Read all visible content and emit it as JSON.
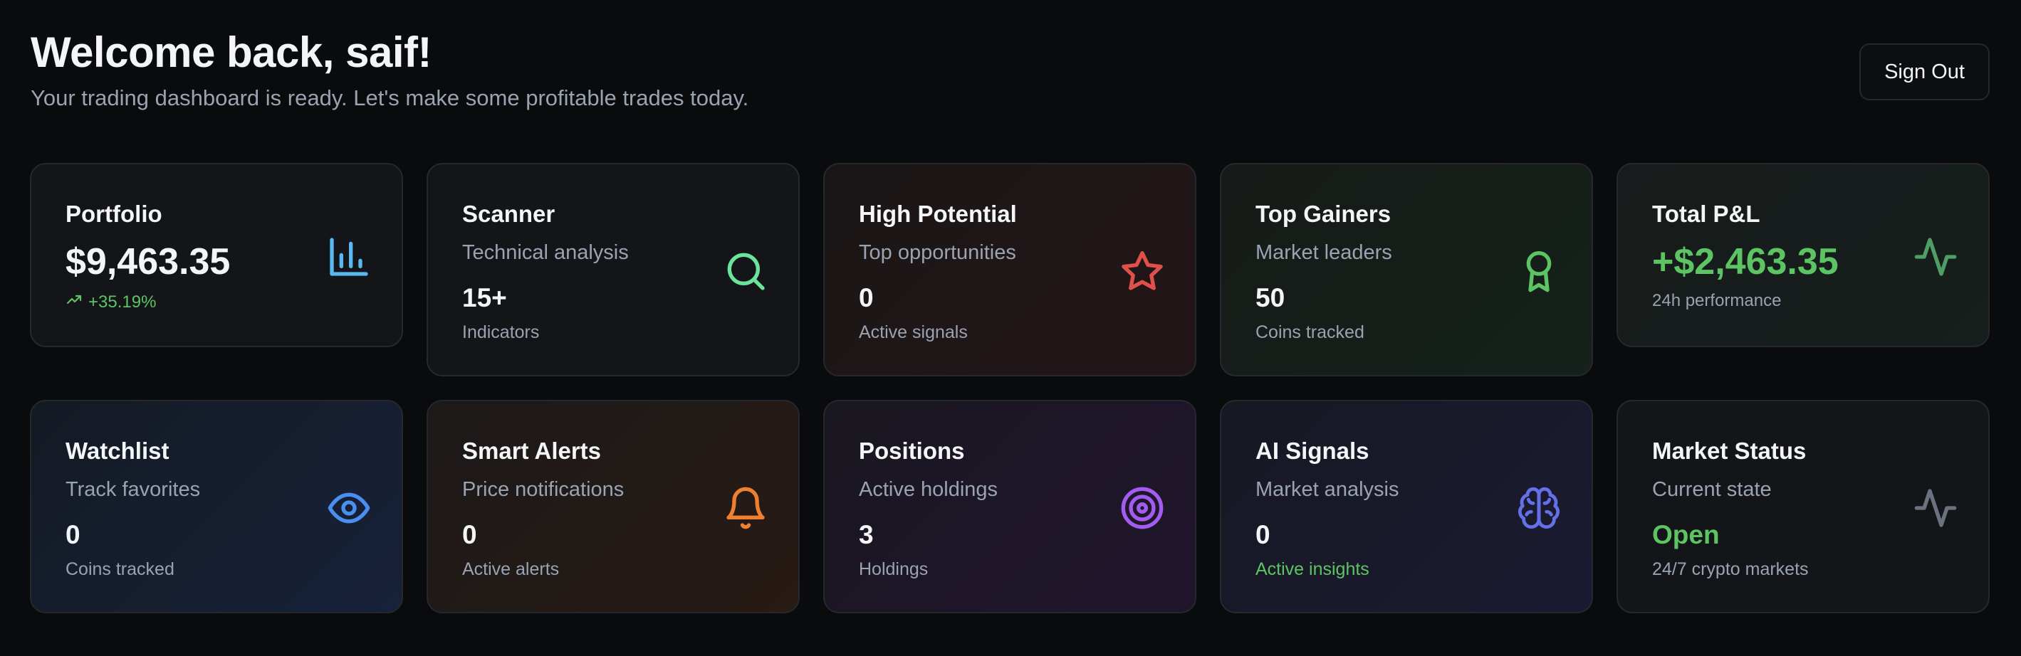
{
  "header": {
    "title": "Welcome back, saif!",
    "subtitle": "Your trading dashboard is ready. Let's make some profitable trades today.",
    "signout_label": "Sign Out"
  },
  "cards": {
    "portfolio": {
      "title": "Portfolio",
      "value": "$9,463.35",
      "change": "+35.19%",
      "icon": "bar-chart-icon",
      "accent": "#5ab8f0"
    },
    "scanner": {
      "title": "Scanner",
      "subtitle": "Technical analysis",
      "value": "15+",
      "footer": "Indicators",
      "icon": "search-icon",
      "accent": "#6be39a"
    },
    "high_potential": {
      "title": "High Potential",
      "subtitle": "Top opportunities",
      "value": "0",
      "footer": "Active signals",
      "icon": "star-icon",
      "accent": "#e0504a"
    },
    "top_gainers": {
      "title": "Top Gainers",
      "subtitle": "Market leaders",
      "value": "50",
      "footer": "Coins tracked",
      "icon": "award-icon",
      "accent": "#5cc462"
    },
    "total_pnl": {
      "title": "Total P&L",
      "value": "+$2,463.35",
      "footer": "24h performance",
      "icon": "activity-icon",
      "accent": "#5cc462"
    },
    "watchlist": {
      "title": "Watchlist",
      "subtitle": "Track favorites",
      "value": "0",
      "footer": "Coins tracked",
      "icon": "eye-icon",
      "accent": "#4a8ff0"
    },
    "smart_alerts": {
      "title": "Smart Alerts",
      "subtitle": "Price notifications",
      "value": "0",
      "footer": "Active alerts",
      "icon": "bell-icon",
      "accent": "#ef8030"
    },
    "positions": {
      "title": "Positions",
      "subtitle": "Active holdings",
      "value": "3",
      "footer": "Holdings",
      "icon": "target-icon",
      "accent": "#a45cf0"
    },
    "ai_signals": {
      "title": "AI Signals",
      "subtitle": "Market analysis",
      "value": "0",
      "footer": "Active insights",
      "icon": "brain-icon",
      "accent": "#6470e8"
    },
    "market_status": {
      "title": "Market Status",
      "subtitle": "Current state",
      "value": "Open",
      "footer": "24/7 crypto markets",
      "icon": "activity-icon",
      "accent": "#6b7280"
    }
  }
}
